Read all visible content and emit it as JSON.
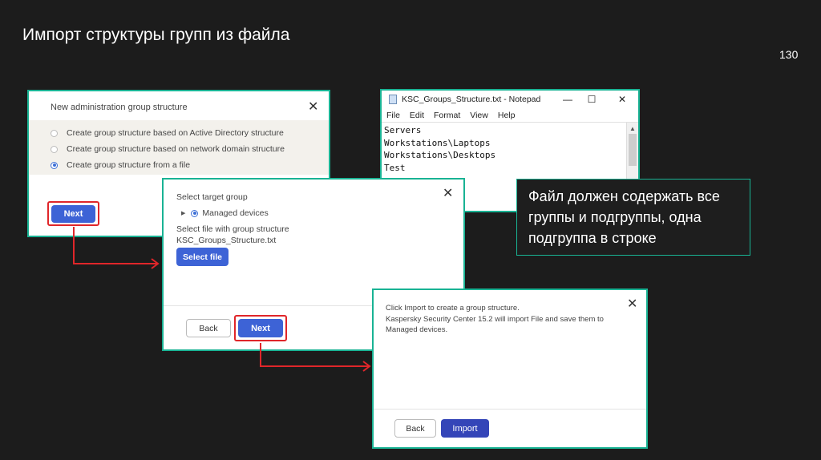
{
  "slide": {
    "title": "Импорт структуры групп из файла",
    "page_number": "130"
  },
  "dialog_structure": {
    "header": "New administration group structure",
    "close_icon": "close-icon",
    "options": [
      {
        "label": "Create group structure based on Active Directory structure",
        "selected": false
      },
      {
        "label": "Create group structure based on network domain structure",
        "selected": false
      },
      {
        "label": "Create group structure from a file",
        "selected": true
      }
    ],
    "next_label": "Next"
  },
  "notepad": {
    "title": "KSC_Groups_Structure.txt - Notepad",
    "minimize_glyph": "—",
    "maximize_glyph": "☐",
    "close_glyph": "✕",
    "menu": [
      "File",
      "Edit",
      "Format",
      "View",
      "Help"
    ],
    "lines": [
      "Servers",
      "Workstations\\Laptops",
      "Workstations\\Desktops",
      "Test"
    ]
  },
  "dialog_target": {
    "select_target_label": "Select target group",
    "tree_item": "Managed devices",
    "select_file_label": "Select file with group structure",
    "file_name": "KSC_Groups_Structure.txt",
    "select_file_button": "Select file",
    "back_label": "Back",
    "next_label": "Next"
  },
  "dialog_import": {
    "message_line1": "Click Import to create a group structure.",
    "message_line2": "Kaspersky Security Center 15.2 will import File and save them to Managed devices.",
    "back_label": "Back",
    "import_label": "Import"
  },
  "callout": {
    "text": "Файл должен содержать все группы и подгруппы, одна подгруппа в строке"
  },
  "colors": {
    "accent_border": "#19b394",
    "primary_button": "#3d63d6",
    "highlight_red": "#e0262a",
    "background": "#1c1c1c"
  }
}
